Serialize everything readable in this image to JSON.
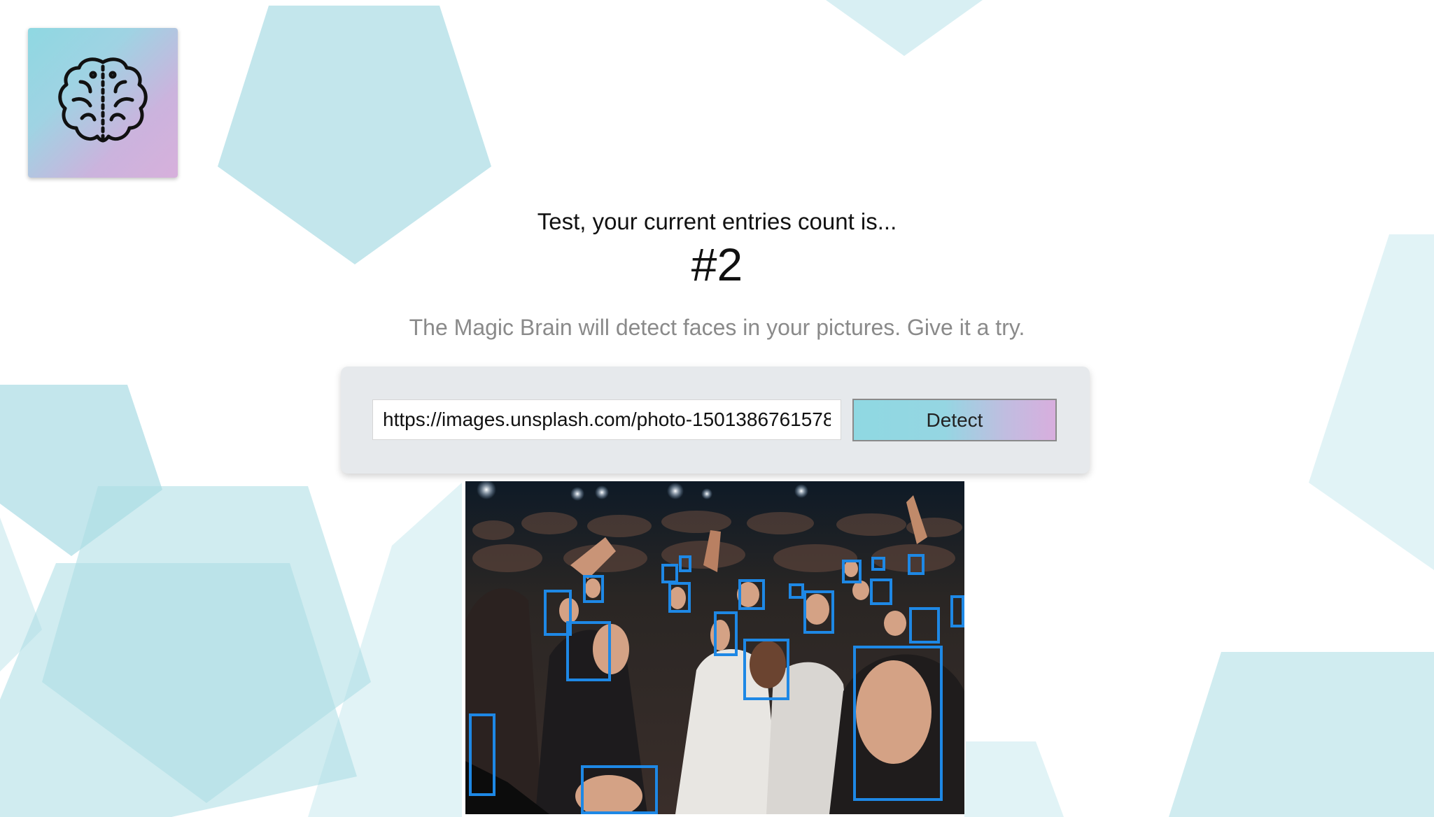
{
  "logo": {
    "icon": "brain-icon"
  },
  "rank": {
    "name_line": "Test, your current entries count is...",
    "count_line": "#2"
  },
  "tagline": "The Magic Brain will detect faces in your pictures. Give it a try.",
  "form": {
    "input_value": "https://images.unsplash.com/photo-1501386761578",
    "detect_label": "Detect"
  },
  "image": {
    "subject": "concert crowd photo",
    "faces_detected": 24
  },
  "colors": {
    "accent_cyan": "#8fd8e2",
    "accent_purple": "#d7b0dc",
    "face_box": "#1e88e5",
    "background_shapes": "#a9dce4"
  }
}
